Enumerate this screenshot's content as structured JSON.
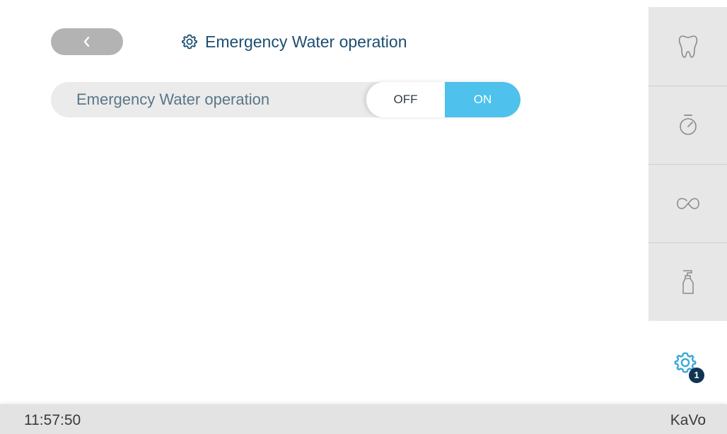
{
  "header": {
    "title": "Emergency Water operation",
    "title_icon": "gear-icon",
    "back_icon": "chevron-left-icon"
  },
  "setting": {
    "label": "Emergency Water operation",
    "options": {
      "off": "OFF",
      "on": "ON"
    },
    "selected": "ON"
  },
  "sidebar": {
    "items": [
      {
        "icon": "tooth-icon"
      },
      {
        "icon": "stopwatch-icon"
      },
      {
        "icon": "infinity-icon"
      },
      {
        "icon": "spray-bottle-icon"
      }
    ]
  },
  "settings_button": {
    "icon": "gear-icon",
    "badge": "1"
  },
  "status_bar": {
    "time": "11:57:50",
    "brand": "KaVo"
  },
  "colors": {
    "accent": "#4ec1ec",
    "title": "#1d4f72",
    "badge": "#0f3553",
    "back_button": "#b3b3b3"
  }
}
